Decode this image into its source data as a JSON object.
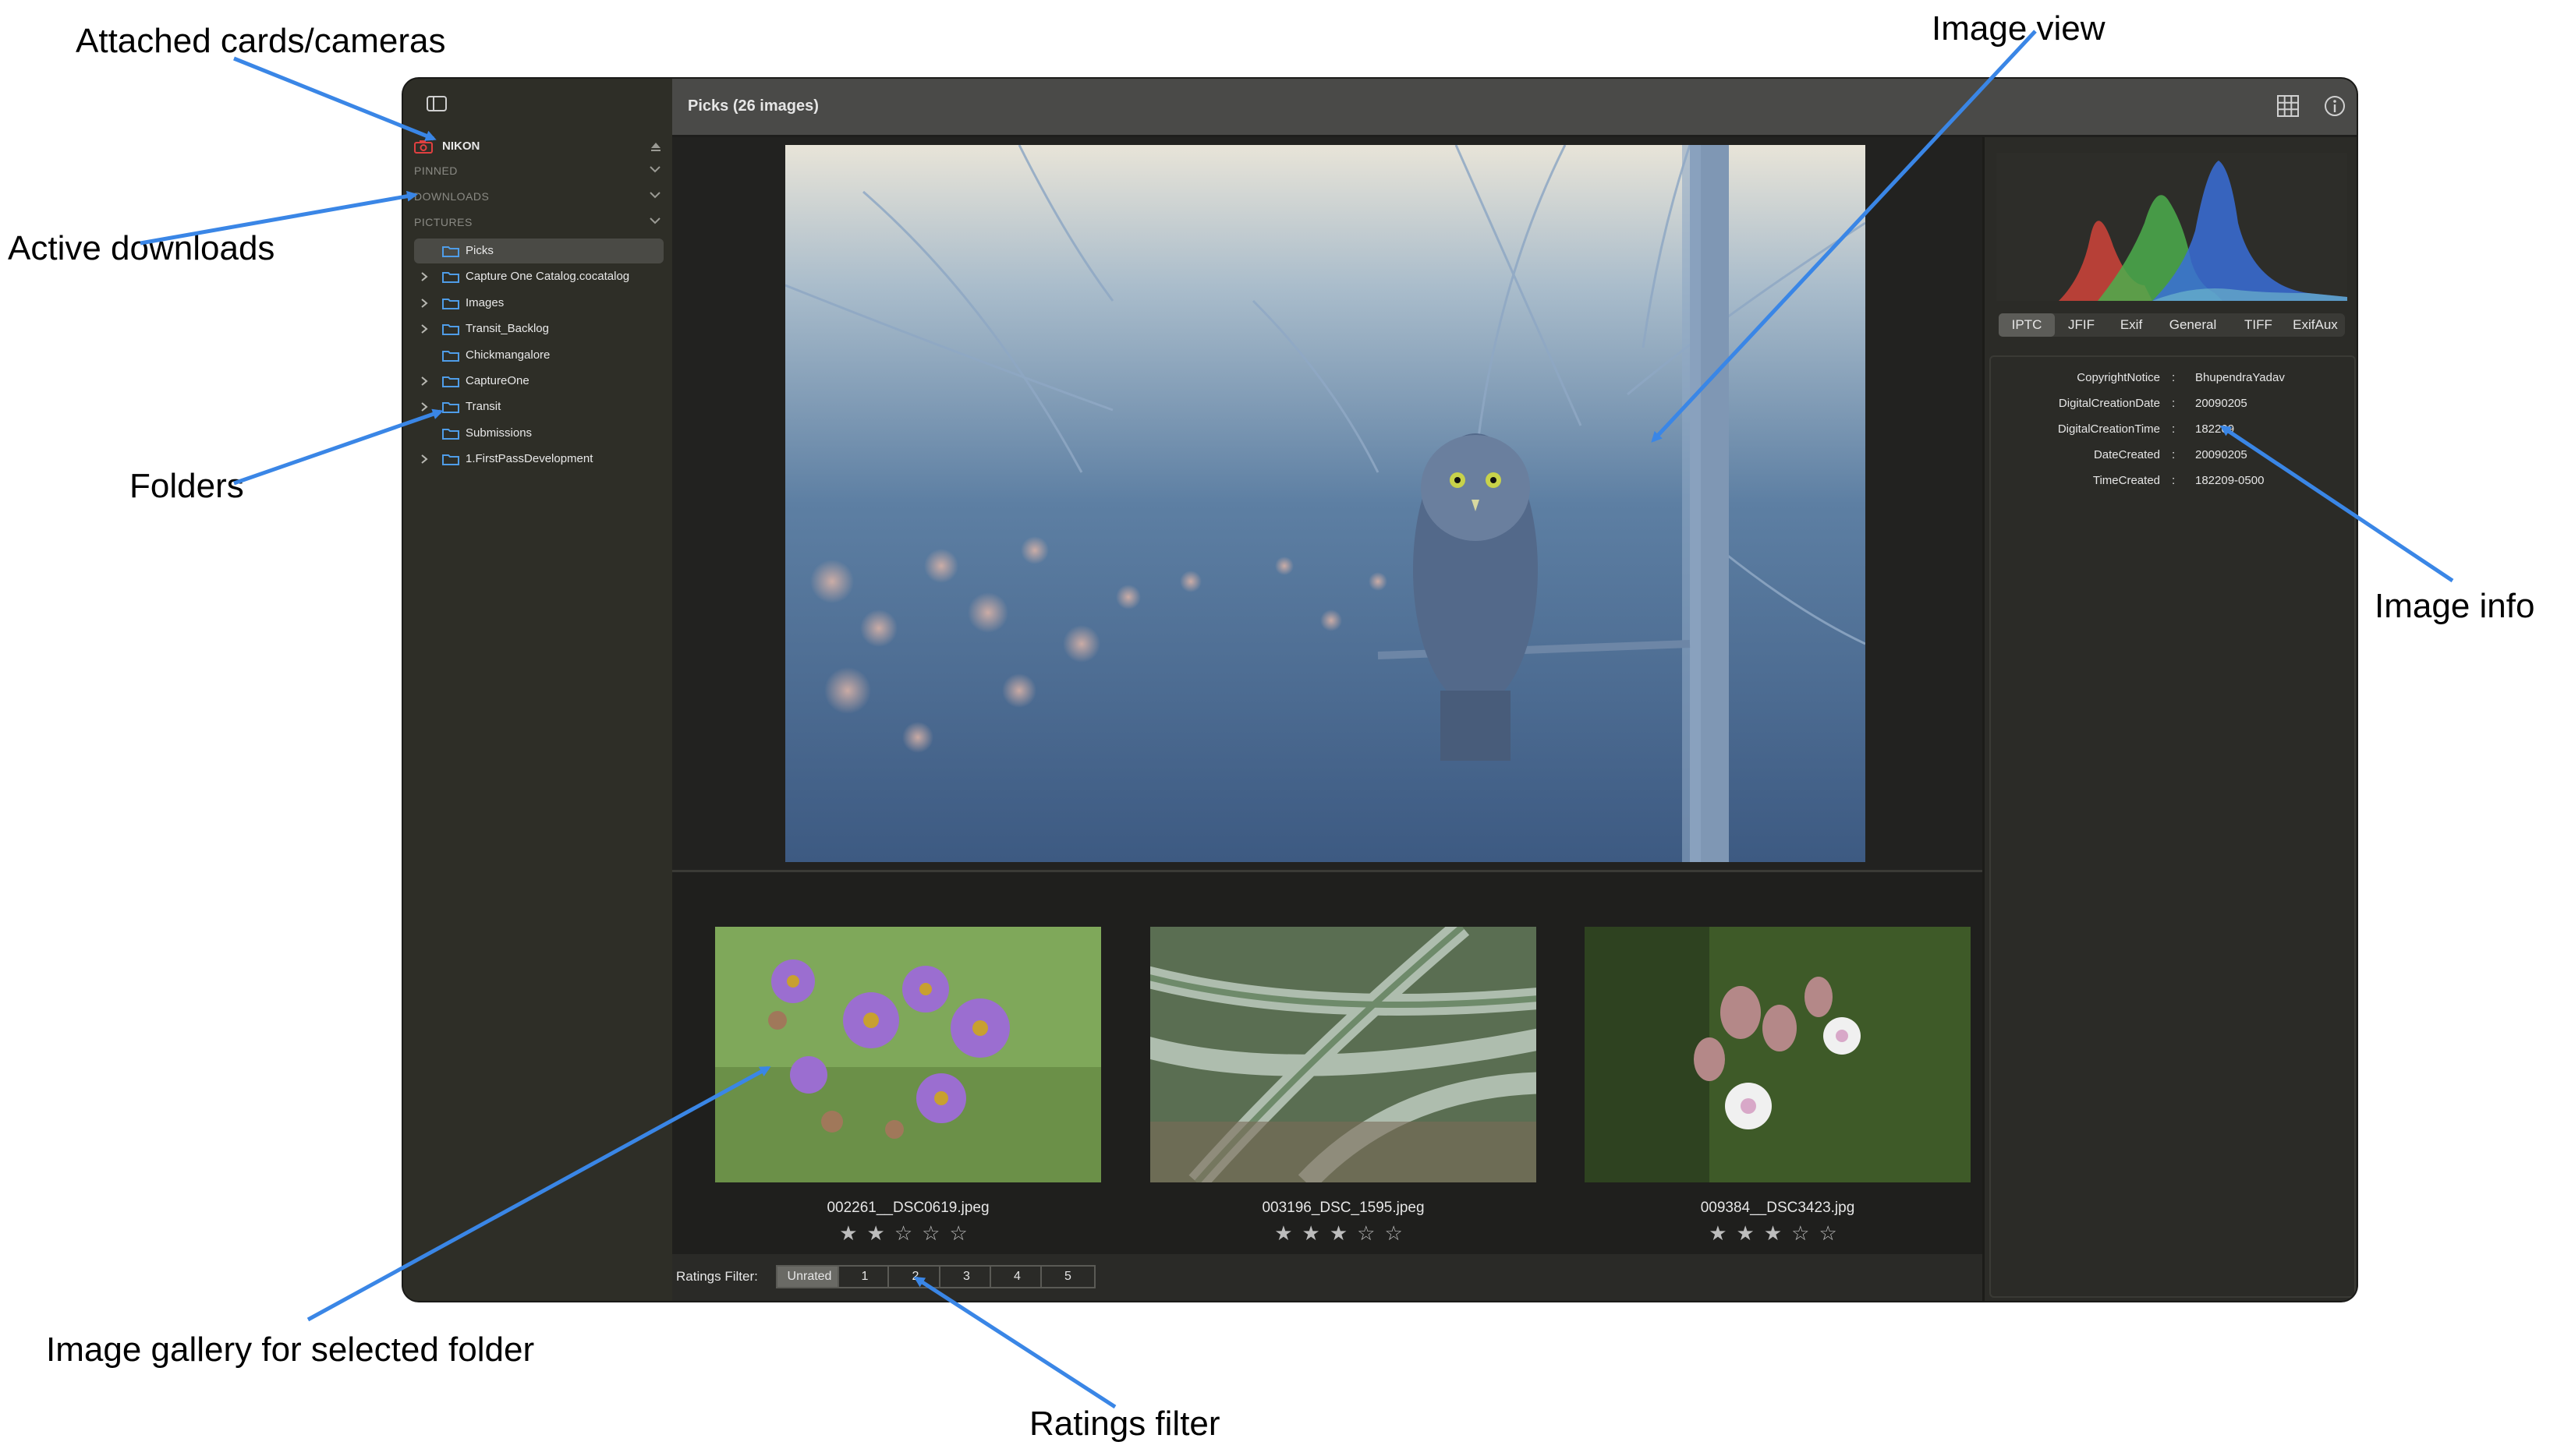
{
  "annotations": {
    "attached_cards": "Attached cards/cameras",
    "active_downloads": "Active downloads",
    "folders": "Folders",
    "image_view": "Image view",
    "image_info": "Image info",
    "image_gallery": "Image gallery for selected folder",
    "ratings_filter": "Ratings filter"
  },
  "toolbar": {
    "title": "Picks (26 images)",
    "grid_icon": "grid-icon",
    "info_icon": "info-icon"
  },
  "sidebar": {
    "device": {
      "label": "NIKON",
      "icon": "camera-icon",
      "eject_icon": "eject-icon"
    },
    "sections": {
      "pinned": "PINNED",
      "downloads": "DOWNLOADS",
      "pictures": "PICTURES"
    },
    "folders": [
      {
        "label": "Picks",
        "selected": true,
        "expandable": false
      },
      {
        "label": "Capture One Catalog.cocatalog",
        "expandable": true
      },
      {
        "label": "Images",
        "expandable": true
      },
      {
        "label": "Transit_Backlog",
        "expandable": true
      },
      {
        "label": "Chickmangalore",
        "expandable": false
      },
      {
        "label": "CaptureOne",
        "expandable": true
      },
      {
        "label": "Transit",
        "expandable": true
      },
      {
        "label": "Submissions",
        "expandable": false
      },
      {
        "label": "1.FirstPassDevelopment",
        "expandable": true
      }
    ]
  },
  "gallery": {
    "items": [
      {
        "filename": "002261__DSC0619.jpeg",
        "rating": 2
      },
      {
        "filename": "003196_DSC_1595.jpeg",
        "rating": 3
      },
      {
        "filename": "009384__DSC3423.jpg",
        "rating": 3
      }
    ]
  },
  "ratings_filter": {
    "label": "Ratings Filter:",
    "options": [
      "Unrated",
      "1",
      "2",
      "3",
      "4",
      "5"
    ],
    "active": "Unrated"
  },
  "info_panel": {
    "tabs": [
      "IPTC",
      "JFIF",
      "Exif",
      "General",
      "TIFF",
      "ExifAux"
    ],
    "active_tab": "IPTC",
    "metadata": [
      {
        "key": "CopyrightNotice",
        "value": "BhupendraYadav"
      },
      {
        "key": "DigitalCreationDate",
        "value": "20090205"
      },
      {
        "key": "DigitalCreationTime",
        "value": "182209"
      },
      {
        "key": "DateCreated",
        "value": "20090205"
      },
      {
        "key": "TimeCreated",
        "value": "182209-0500"
      }
    ]
  }
}
